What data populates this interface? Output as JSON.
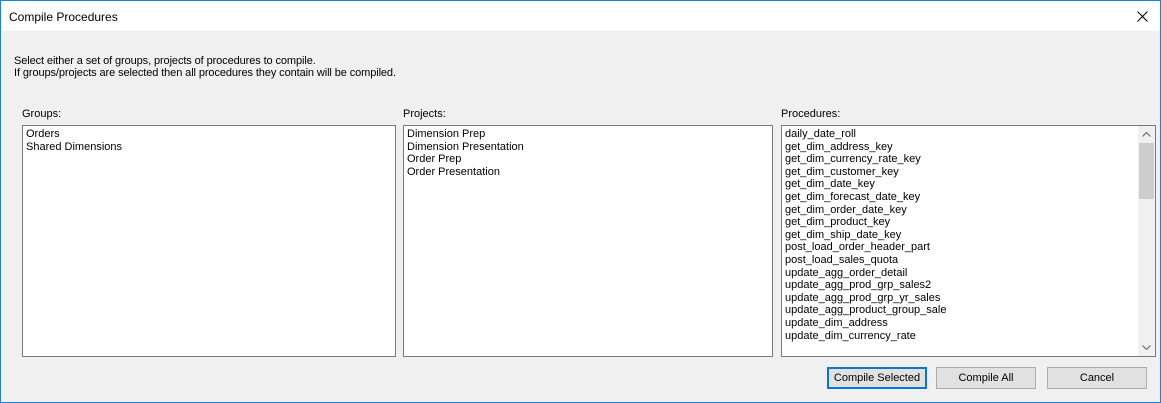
{
  "dialog": {
    "title": "Compile Procedures",
    "description_line1": "Select either a set of groups, projects of procedures to compile.",
    "description_line2": "If groups/projects are selected then all procedures they contain will be compiled."
  },
  "groups": {
    "label": "Groups:",
    "items": [
      "Orders",
      "Shared Dimensions"
    ]
  },
  "projects": {
    "label": "Projects:",
    "items": [
      "Dimension Prep",
      "Dimension Presentation",
      "Order Prep",
      "Order Presentation"
    ]
  },
  "procedures": {
    "label": "Procedures:",
    "items": [
      "daily_date_roll",
      "get_dim_address_key",
      "get_dim_currency_rate_key",
      "get_dim_customer_key",
      "get_dim_date_key",
      "get_dim_forecast_date_key",
      "get_dim_order_date_key",
      "get_dim_product_key",
      "get_dim_ship_date_key",
      "post_load_order_header_part",
      "post_load_sales_quota",
      "update_agg_order_detail",
      "update_agg_prod_grp_sales2",
      "update_agg_prod_grp_yr_sales",
      "update_agg_product_group_sale",
      "update_dim_address",
      "update_dim_currency_rate"
    ]
  },
  "buttons": {
    "compile_selected": "Compile Selected",
    "compile_all": "Compile All",
    "cancel": "Cancel"
  },
  "icons": {
    "close": "close-icon",
    "scroll_up": "chevron-up-icon",
    "scroll_down": "chevron-down-icon"
  },
  "colors": {
    "window_border": "#1883d7",
    "default_button_border": "#0078d7",
    "dialog_background": "#f0f0f0"
  }
}
